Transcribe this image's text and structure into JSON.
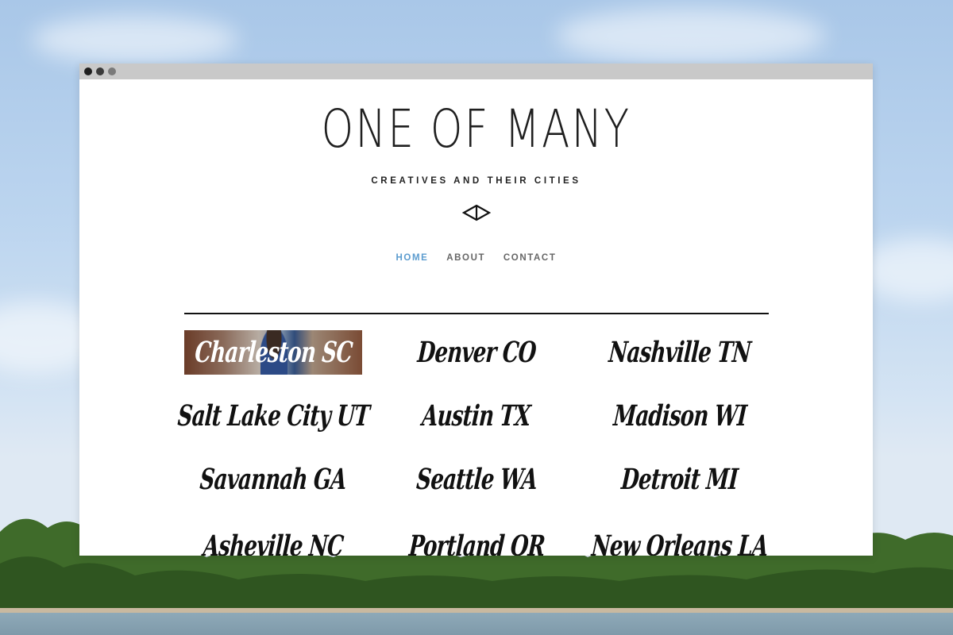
{
  "site": {
    "title": "ONE OF MANY",
    "tagline": "CREATIVES AND THEIR CITIES",
    "emblem_icon": "diamond-arrow-logo-icon"
  },
  "nav": {
    "items": [
      {
        "label": "HOME",
        "active": true
      },
      {
        "label": "ABOUT",
        "active": false
      },
      {
        "label": "CONTACT",
        "active": false
      }
    ],
    "active_color": "#5c9ccf"
  },
  "cities": [
    {
      "label": "Charleston SC",
      "featured": true
    },
    {
      "label": "Denver CO",
      "featured": false
    },
    {
      "label": "Nashville TN",
      "featured": false
    },
    {
      "label": "Salt Lake City UT",
      "featured": false
    },
    {
      "label": "Austin TX",
      "featured": false
    },
    {
      "label": "Madison WI",
      "featured": false
    },
    {
      "label": "Savannah GA",
      "featured": false
    },
    {
      "label": "Seattle WA",
      "featured": false
    },
    {
      "label": "Detroit MI",
      "featured": false
    },
    {
      "label": "Asheville NC",
      "featured": false
    },
    {
      "label": "Portland OR",
      "featured": false
    },
    {
      "label": "New Orleans LA",
      "featured": false
    }
  ],
  "browser": {
    "window_controls": [
      "close-dot",
      "minimize-dot",
      "maximize-dot"
    ],
    "chrome_color": "#c9c9c9"
  }
}
